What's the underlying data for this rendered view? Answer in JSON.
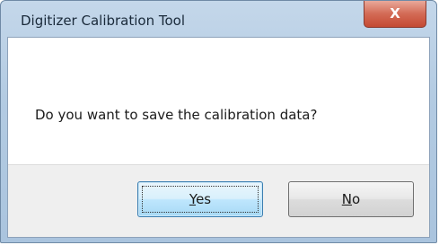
{
  "window": {
    "title": "Digitizer Calibration Tool",
    "close_label": "X"
  },
  "dialog": {
    "message": "Do you want to save the calibration data?"
  },
  "buttons": {
    "yes": {
      "accel": "Y",
      "rest": "es"
    },
    "no": {
      "accel": "N",
      "rest": "o"
    }
  },
  "icons": {
    "close": "close-icon"
  },
  "colors": {
    "title_bar": "#b3cbe2",
    "close_button": "#d36a55",
    "default_button": "#bee6fd"
  }
}
